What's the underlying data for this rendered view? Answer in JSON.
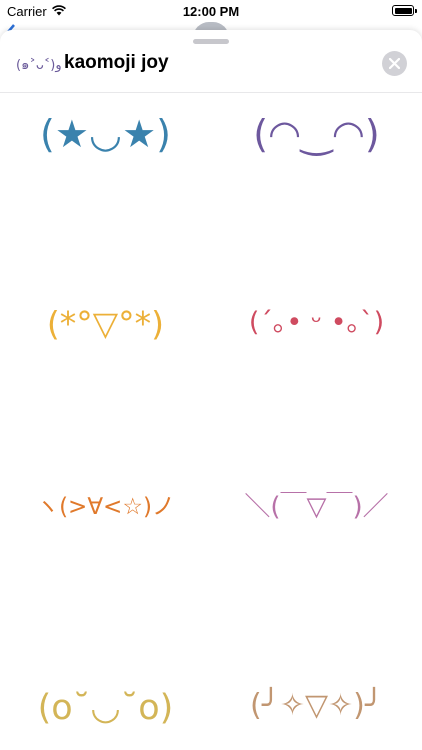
{
  "status_bar": {
    "carrier": "Carrier",
    "time": "12:00 PM",
    "wifi_icon": "wifi-icon",
    "battery_level": 1.0
  },
  "header": {
    "app_icon": "(๑˃ᴗ˂)ﻭ",
    "title": "kaomoji joy",
    "close_icon": "close-icon"
  },
  "stickers": [
    {
      "text": "(★◡★)",
      "color": "#3a82ad"
    },
    {
      "text": "(◠‿◠)",
      "color": "#6d589e"
    },
    {
      "text": "(*°▽°*)",
      "color": "#ecb038"
    },
    {
      "text": "(´｡• ᵕ •｡`)",
      "color": "#cf4b60"
    },
    {
      "text": "ヽ(>∀<☆)ノ",
      "color": "#e0792b"
    },
    {
      "text": "＼(￣▽￣)／",
      "color": "#b771a8"
    },
    {
      "text": "(o˘◡˘o)",
      "color": "#d3b557"
    },
    {
      "text": "(╯✧▽✧)╯",
      "color": "#c19671"
    }
  ]
}
